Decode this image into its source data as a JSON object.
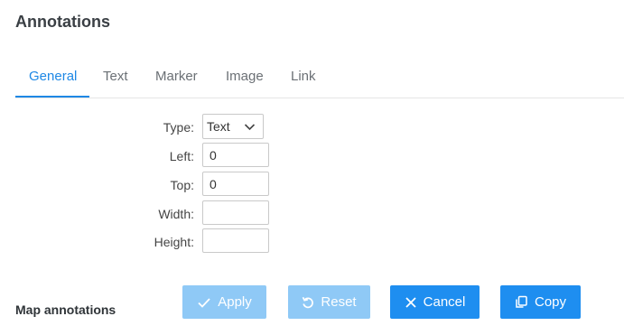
{
  "header": {
    "title": "Annotations"
  },
  "tabs": [
    {
      "label": "General",
      "active": true
    },
    {
      "label": "Text"
    },
    {
      "label": "Marker"
    },
    {
      "label": "Image"
    },
    {
      "label": "Link"
    }
  ],
  "form": {
    "type_label": "Type:",
    "type_value": "Text",
    "left_label": "Left:",
    "left_value": "0",
    "top_label": "Top:",
    "top_value": "0",
    "width_label": "Width:",
    "width_value": "",
    "height_label": "Height:",
    "height_value": ""
  },
  "footer": {
    "section_label": "Map annotations",
    "buttons": {
      "apply": "Apply",
      "reset": "Reset",
      "cancel": "Cancel",
      "copy": "Copy"
    }
  },
  "colors": {
    "accent": "#1e88e5",
    "primary_button": "#1e8ef0",
    "disabled_button": "#8fc9f6"
  },
  "icons": {
    "apply": "check-icon",
    "reset": "rotate-ccw-icon",
    "cancel": "close-icon",
    "copy": "copy-icon",
    "type_dropdown": "chevron-down-icon"
  }
}
